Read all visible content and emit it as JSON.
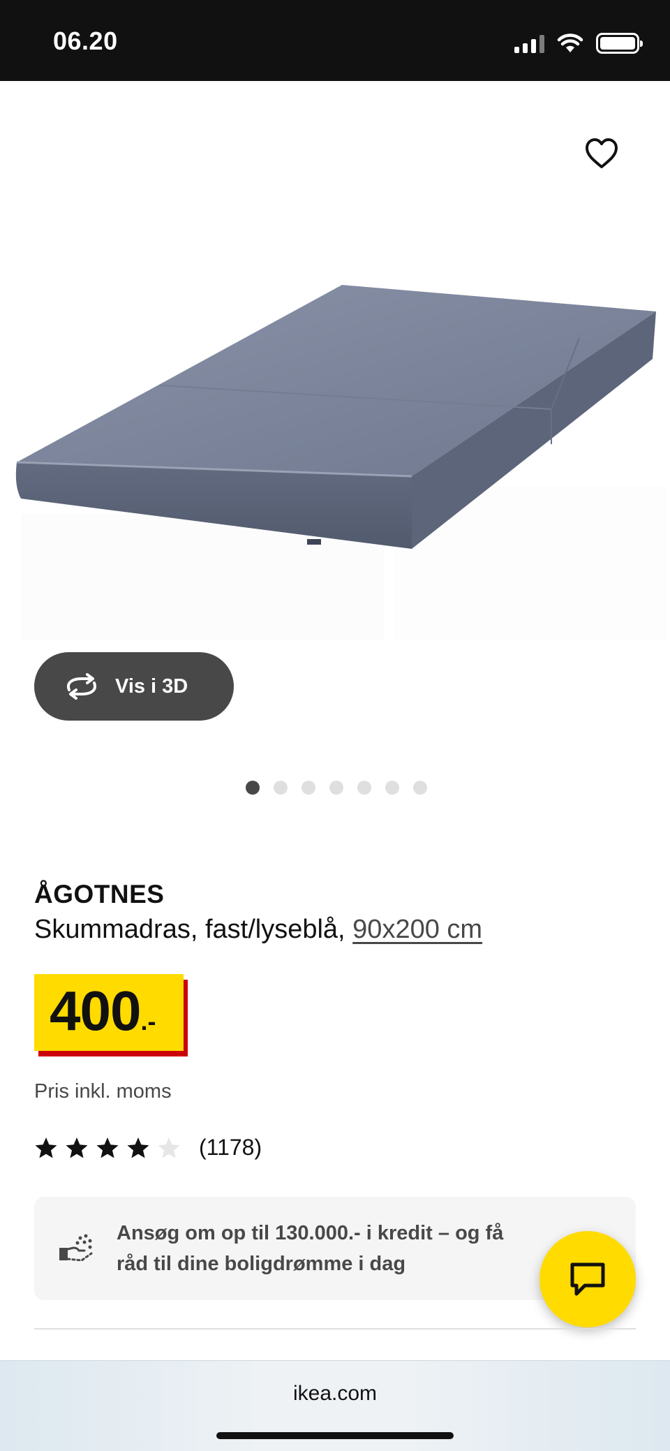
{
  "status_bar": {
    "time": "06.20",
    "icons": [
      "signal-icon",
      "wifi-icon",
      "battery-icon"
    ]
  },
  "gallery": {
    "favorite_icon": "heart-outline-icon",
    "view_3d_label": "Vis i 3D",
    "view_3d_icon": "rotate-icon",
    "image_count": 7,
    "active_image_index": 0
  },
  "product": {
    "name": "ÅGOTNES",
    "description": "Skummadras, fast/lyseblå,",
    "size_link": "90x200 cm",
    "price_value": "400",
    "price_suffix": ".-",
    "price_note": "Pris inkl. moms",
    "rating": {
      "stars": 4,
      "max_stars": 5,
      "count_label": "(1178)"
    }
  },
  "credit_banner": {
    "icon": "credit-hand-icon",
    "text": "Ansøg om op til 130.000.- i kredit – og få råd til dine boligdrømme i dag"
  },
  "chat_button": {
    "icon": "chat-bubble-icon"
  },
  "browser": {
    "url": "ikea.com"
  },
  "colors": {
    "ikea_yellow": "#ffdb00",
    "price_red": "#cc0008",
    "dark_gray": "#484848",
    "banner_bg": "#f5f5f5"
  }
}
